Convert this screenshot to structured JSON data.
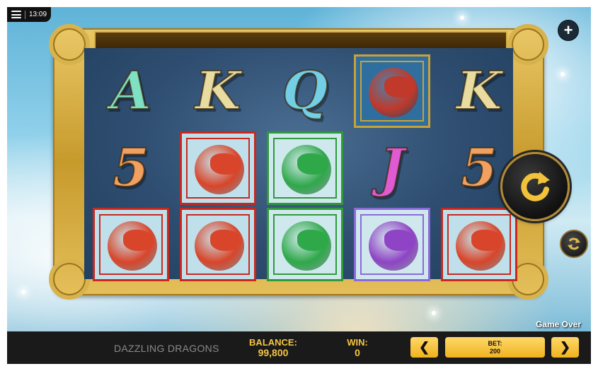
{
  "status_bar": {
    "time": "13:09"
  },
  "reels": {
    "grid": [
      [
        "A",
        "K",
        "Q",
        "red-dragon-gold",
        "K"
      ],
      [
        "5",
        "red-dragon",
        "green-dragon",
        "J",
        "5"
      ],
      [
        "red-dragon",
        "red-dragon",
        "green-dragon",
        "purple-dragon",
        "red-dragon"
      ]
    ],
    "symbol_colors": {
      "A": "#7fe0c4",
      "K": "#e8dca0",
      "Q": "#72cfe6",
      "J": "#e05ad2",
      "5": "#f0a060"
    }
  },
  "labels": {
    "game_over": "Game Over",
    "game_title": "DAZZLING DRAGONS",
    "balance_label": "BALANCE:",
    "balance_value": "99,800",
    "win_label": "WIN:",
    "win_value": "0",
    "bet_label": "BET:",
    "bet_value": "200",
    "bet_prev": "❮",
    "bet_next": "❯",
    "plus": "+"
  },
  "icons": {
    "menu": "menu-icon",
    "plus": "plus-icon",
    "spin": "spin-arrow-icon",
    "autoplay": "autoplay-icon"
  },
  "colors": {
    "accent_gold": "#f4c542",
    "frame_gold": "#d6b04b",
    "bar_bg": "#1a1a1a",
    "red_box": "#c8281e",
    "green_box": "#2f9a3a",
    "purple_box": "#8b6ad8"
  }
}
